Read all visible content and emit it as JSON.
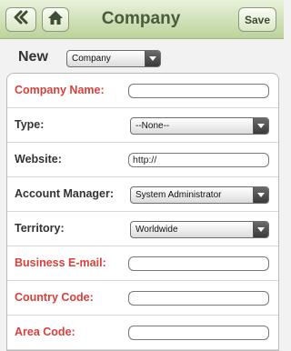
{
  "header": {
    "title": "Company",
    "save_label": "Save"
  },
  "record_type": {
    "label": "New",
    "selected": "Company"
  },
  "fields": {
    "company_name": {
      "label": "Company Name:",
      "required": true,
      "value": ""
    },
    "type": {
      "label": "Type:",
      "required": false,
      "value": "--None--"
    },
    "website": {
      "label": "Website:",
      "required": false,
      "value": "http://"
    },
    "account_manager": {
      "label": "Account Manager:",
      "required": false,
      "value": "System Administrator"
    },
    "territory": {
      "label": "Territory:",
      "required": false,
      "value": "Worldwide"
    },
    "business_email": {
      "label": "Business E-mail:",
      "required": true,
      "value": ""
    },
    "country_code": {
      "label": "Country Code:",
      "required": true,
      "value": ""
    },
    "area_code": {
      "label": "Area Code:",
      "required": true,
      "value": ""
    }
  },
  "icons": {
    "back": "double-chevron-left-icon",
    "home": "home-icon",
    "dropdown": "dropdown-arrow-icon"
  },
  "colors": {
    "header_gradient_top": "#e9f2dc",
    "header_gradient_bottom": "#bcd39c",
    "title_text": "#4a5a3e",
    "required_label": "#d9403a",
    "label": "#333333"
  }
}
